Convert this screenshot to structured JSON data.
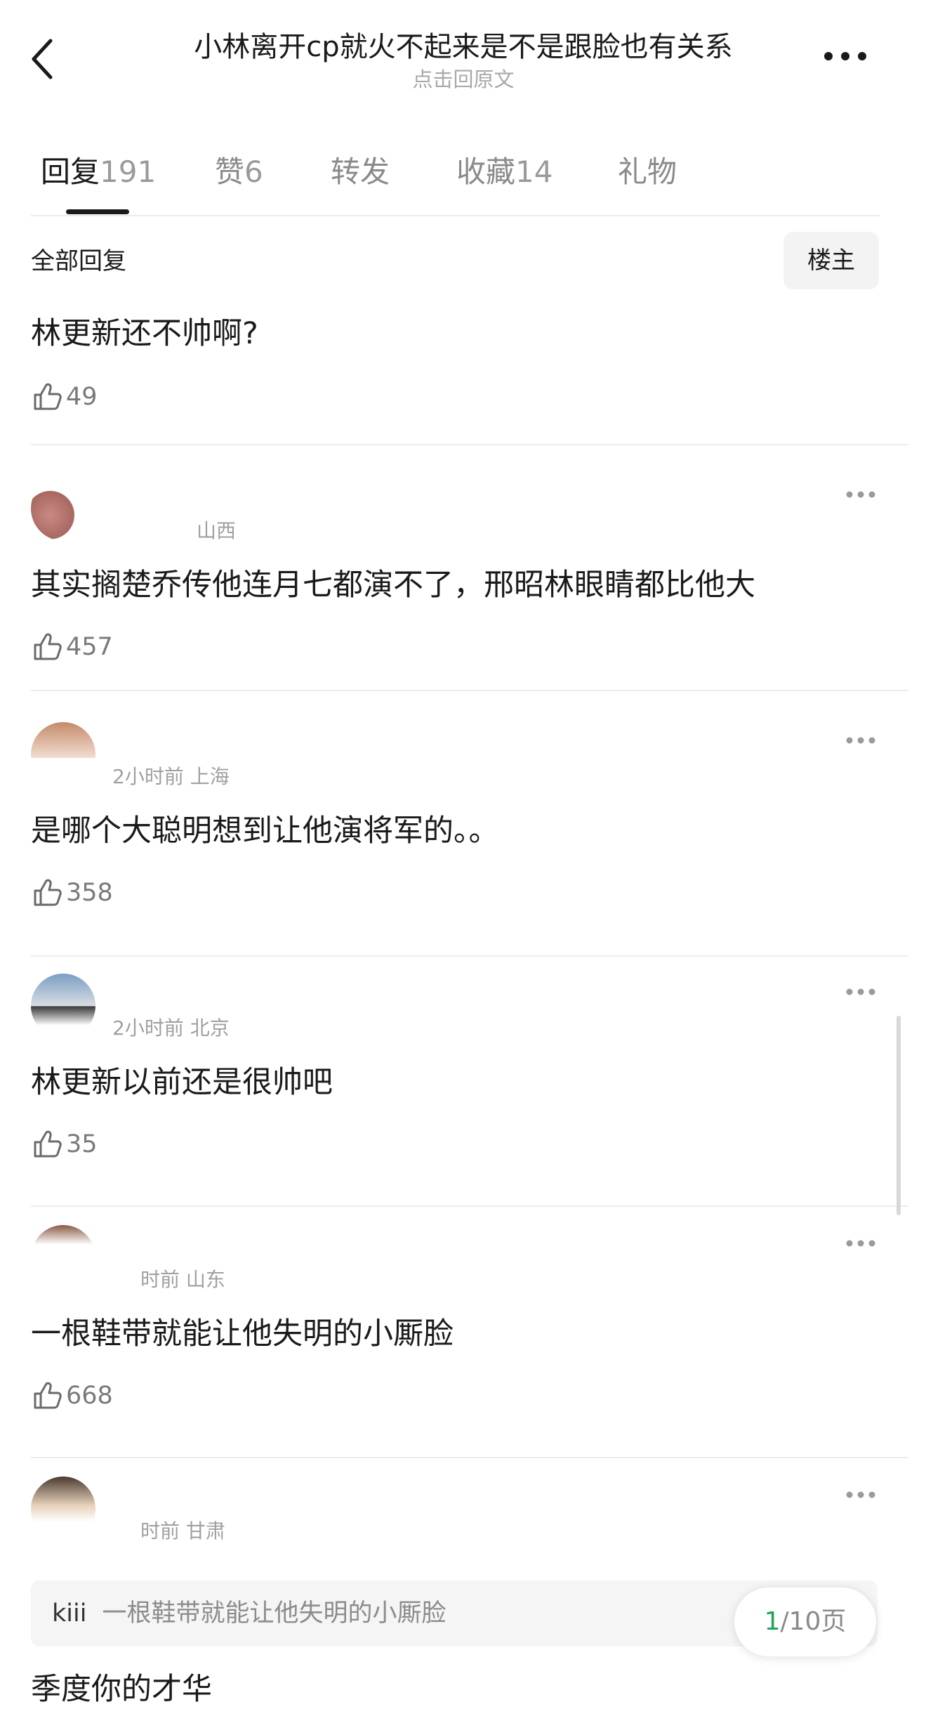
{
  "header": {
    "title": "小林离开cp就火不起来是不是跟脸也有关系",
    "subtitle": "点击回原文",
    "back_icon": "chevron-left-icon",
    "more_icon": "more-horizontal-icon"
  },
  "tabs": [
    {
      "label": "回复",
      "count": "191",
      "active": true
    },
    {
      "label": "赞",
      "count": "6"
    },
    {
      "label": "转发",
      "count": ""
    },
    {
      "label": "收藏",
      "count": "14"
    },
    {
      "label": "礼物",
      "count": ""
    }
  ],
  "filter": {
    "all_replies_label": "全部回复",
    "owner_only_label": "楼主"
  },
  "colors": {
    "accent_green": "#20a35a",
    "text_primary": "#1a1a1a",
    "text_secondary": "#a0a0a0",
    "divider": "#ededed"
  },
  "comments": [
    {
      "text": "林更新还不帅啊?",
      "likes": "49",
      "meta": ""
    },
    {
      "text": "其实搁楚乔传他连月七都演不了，邢昭林眼睛都比他大",
      "likes": "457",
      "meta": "山西"
    },
    {
      "text": "是哪个大聪明想到让他演将军的。。",
      "likes": "358",
      "meta": "2小时前 上海"
    },
    {
      "text": "林更新以前还是很帅吧",
      "likes": "35",
      "meta": "2小时前 北京"
    },
    {
      "text": "一根鞋带就能让他失明的小厮脸",
      "likes": "668",
      "meta": "时前 山东"
    },
    {
      "text": "季度你的才华",
      "likes": "",
      "meta": "时前 甘肃",
      "quote": {
        "author": "kiii",
        "text": "一根鞋带就能让他失明的小厮脸"
      }
    }
  ],
  "pagination": {
    "current": "1",
    "total_text": "/10页"
  },
  "icons": {
    "like": "thumbs-up-icon",
    "comment_more": "more-horizontal-icon"
  }
}
